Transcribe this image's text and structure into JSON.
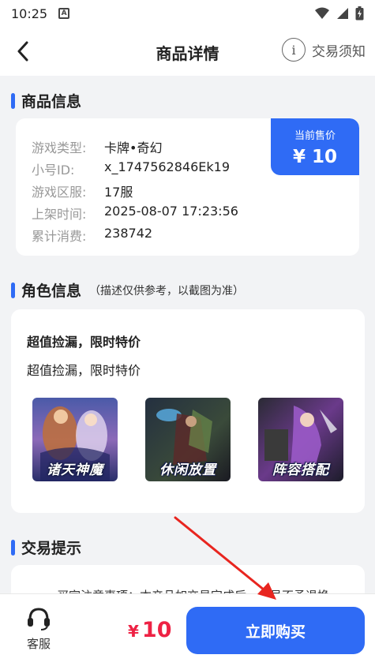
{
  "status": {
    "time": "10:25",
    "indicator": "A"
  },
  "nav": {
    "title": "商品详情",
    "notice_label": "交易须知",
    "notice_icon_glyph": "i"
  },
  "product_section": {
    "title": "商品信息"
  },
  "product": {
    "rows": [
      {
        "key": "游戏类型:",
        "value": "卡牌•奇幻"
      },
      {
        "key": "小号ID:",
        "value": "x_1747562846Ek19"
      },
      {
        "key": "游戏区服:",
        "value": "17服"
      },
      {
        "key": "上架时间:",
        "value": "2025-08-07 17:23:56"
      },
      {
        "key": "累计消费:",
        "value": "238742"
      }
    ],
    "price_label": "当前售价",
    "price_value": "¥ 10"
  },
  "role_section": {
    "title": "角色信息",
    "note": "（描述仅供参考，以截图为准）"
  },
  "role": {
    "title": "超值捡漏，限时特价",
    "desc": "超值捡漏，限时特价",
    "thumbnails": [
      {
        "caption": "诸天神魔"
      },
      {
        "caption": "休闲放置"
      },
      {
        "caption": "阵容搭配"
      }
    ]
  },
  "trade_section": {
    "title": "交易提示"
  },
  "trade": {
    "text": "一、买家注意事项：本产品如交易完成后，小号不予退换"
  },
  "bottom": {
    "service_label": "客服",
    "currency": "¥",
    "price": "10",
    "buy_label": "立即购买"
  },
  "colors": {
    "accent": "#2f6bf5",
    "price": "#ee2244",
    "arrow": "#e8251f"
  }
}
